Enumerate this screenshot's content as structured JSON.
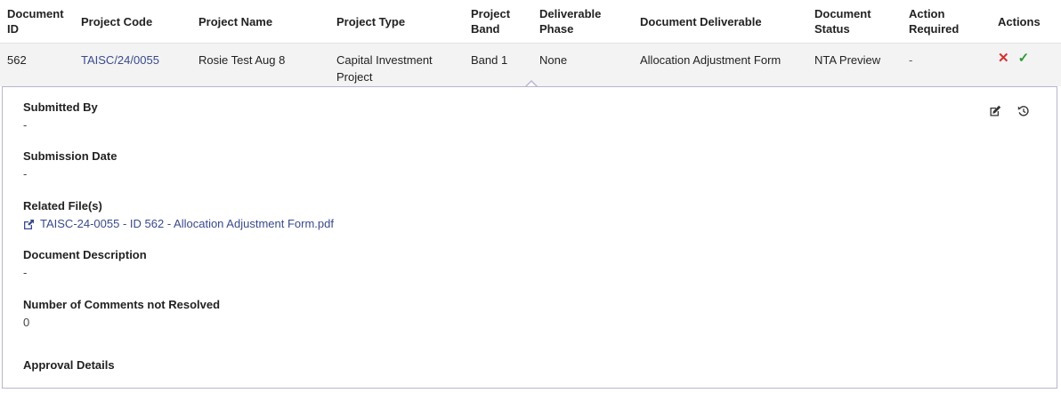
{
  "table": {
    "headers": {
      "document_id": "Document ID",
      "project_code": "Project Code",
      "project_name": "Project Name",
      "project_type": "Project Type",
      "project_band": "Project Band",
      "deliverable_phase": "Deliverable Phase",
      "document_deliverable": "Document Deliverable",
      "document_status": "Document Status",
      "action_required": "Action Required",
      "actions": "Actions"
    },
    "row": {
      "document_id": "562",
      "project_code": "TAISC/24/0055",
      "project_name": "Rosie Test Aug 8",
      "project_type": "Capital Investment Project",
      "project_band": "Band 1",
      "deliverable_phase": "None",
      "document_deliverable": "Allocation Adjustment Form",
      "document_status": "NTA Preview",
      "action_required": "-",
      "reject_icon": "close-icon",
      "approve_icon": "check-icon"
    }
  },
  "details": {
    "submitted_by": {
      "label": "Submitted By",
      "value": "-"
    },
    "submission_date": {
      "label": "Submission Date",
      "value": "-"
    },
    "related_files": {
      "label": "Related File(s)",
      "file": "TAISC-24-0055 - ID 562 - Allocation Adjustment Form.pdf"
    },
    "document_description": {
      "label": "Document Description",
      "value": "-"
    },
    "comments_not_resolved": {
      "label": "Number of Comments not Resolved",
      "value": "0"
    },
    "approval_details": {
      "label": "Approval Details"
    },
    "icons": {
      "edit": "edit-icon",
      "history": "history-icon"
    }
  },
  "colors": {
    "link": "#3a4a8c",
    "reject": "#d62f2f",
    "approve": "#2e9a35",
    "panel_border": "#b9b4cf",
    "row_bg": "#f3f3f3"
  }
}
